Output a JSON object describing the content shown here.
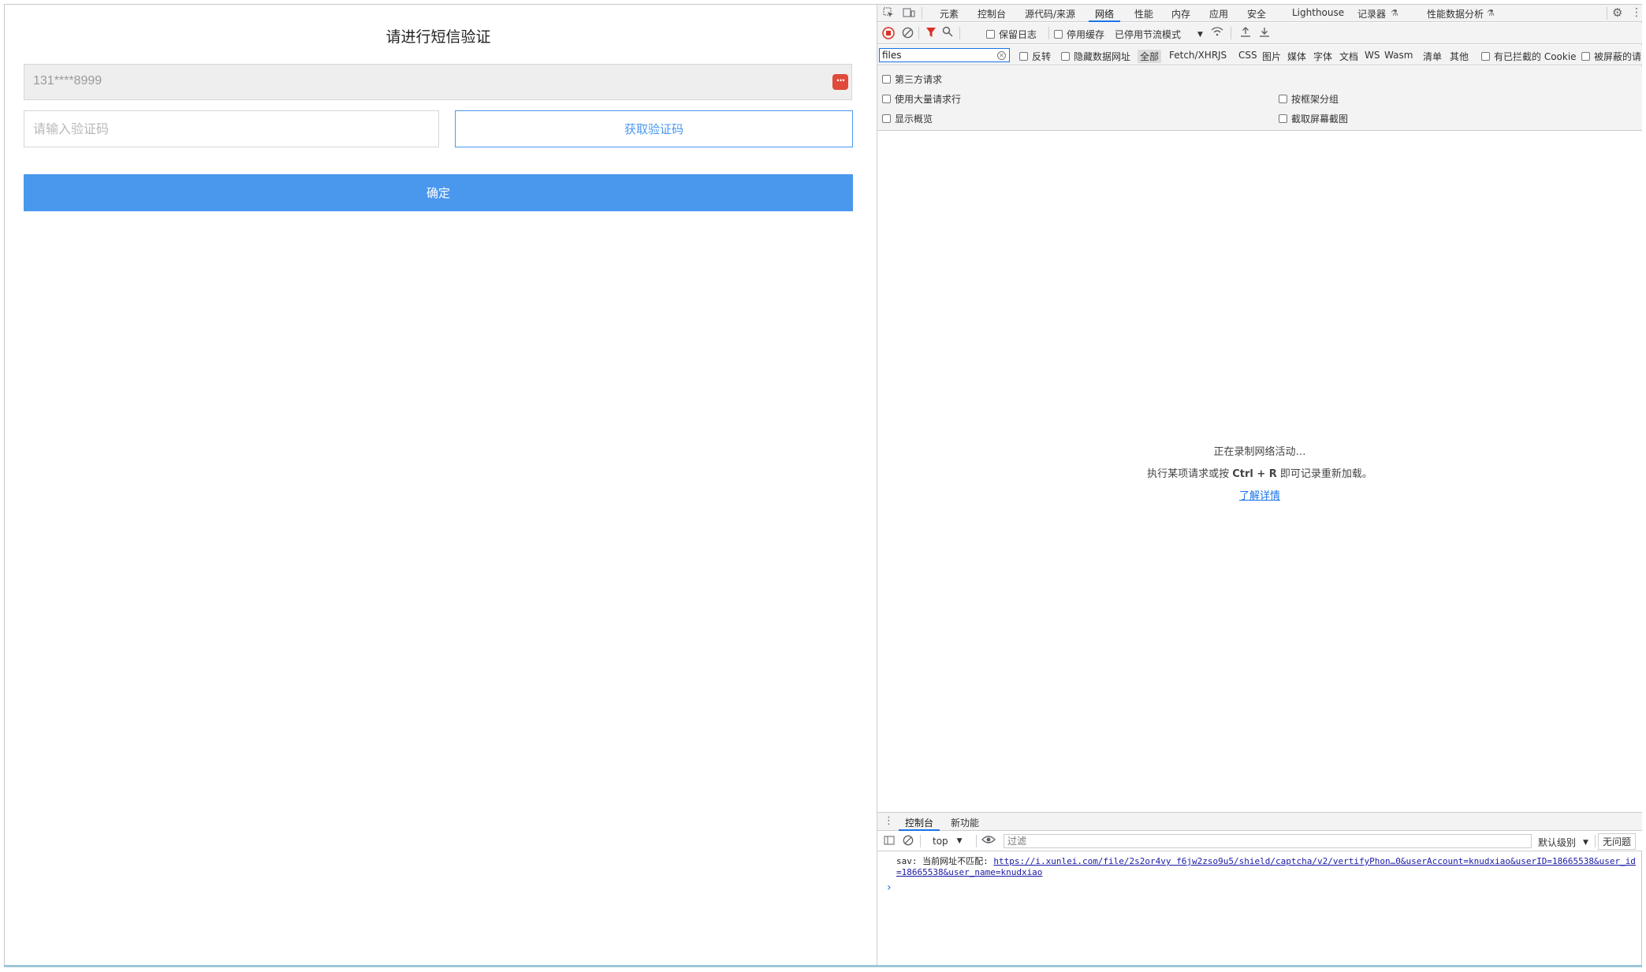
{
  "page": {
    "title": "请进行短信验证",
    "phone_value": "131****8999",
    "code_placeholder": "请输入验证码",
    "get_code_label": "获取验证码",
    "confirm_label": "确定",
    "accent_color": "#4a98ee"
  },
  "devtools": {
    "tabs": [
      "元素",
      "控制台",
      "源代码/来源",
      "网络",
      "性能",
      "内存",
      "应用",
      "安全",
      "Lighthouse",
      "记录器",
      "性能数据分析"
    ],
    "active_tab": "网络",
    "toolbar": {
      "preserve_log": "保留日志",
      "disable_cache": "停用缓存",
      "throttle": "已停用节流模式"
    },
    "filter": {
      "value": "files",
      "invert": "反转",
      "hide_data_urls": "隐藏数据网址",
      "types": [
        "全部",
        "Fetch/XHR",
        "JS",
        "CSS",
        "图片",
        "媒体",
        "字体",
        "文档",
        "WS",
        "Wasm",
        "清单",
        "其他"
      ],
      "blocked_cookies": "有已拦截的 Cookie",
      "blocked_requests": "被屏蔽的请"
    },
    "options": {
      "third_party": "第三方请求",
      "big_rows": "使用大量请求行",
      "group_by_frame": "按框架分组",
      "show_overview": "显示概览",
      "capture_screenshots": "截取屏幕截图"
    },
    "empty": {
      "line1": "正在录制网络活动…",
      "line2_pre": "执行某项请求或按 ",
      "line2_keys": "Ctrl + R",
      "line2_post": " 即可记录重新加载。",
      "link": "了解详情"
    },
    "drawer": {
      "tabs": [
        "控制台",
        "新功能"
      ],
      "context": "top",
      "filter_placeholder": "过滤",
      "level": "默认级别",
      "issues": "无问题"
    },
    "console": {
      "prefix": "sav: 当前网址不匹配: ",
      "url": "https://i.xunlei.com/file/2s2or4vy f6jw2zso9u5/shield/captcha/v2/vertifyPhon…0&userAccount=knudxiao&userID=18665538&user_id=18665538&user_name=knudxiao"
    }
  }
}
